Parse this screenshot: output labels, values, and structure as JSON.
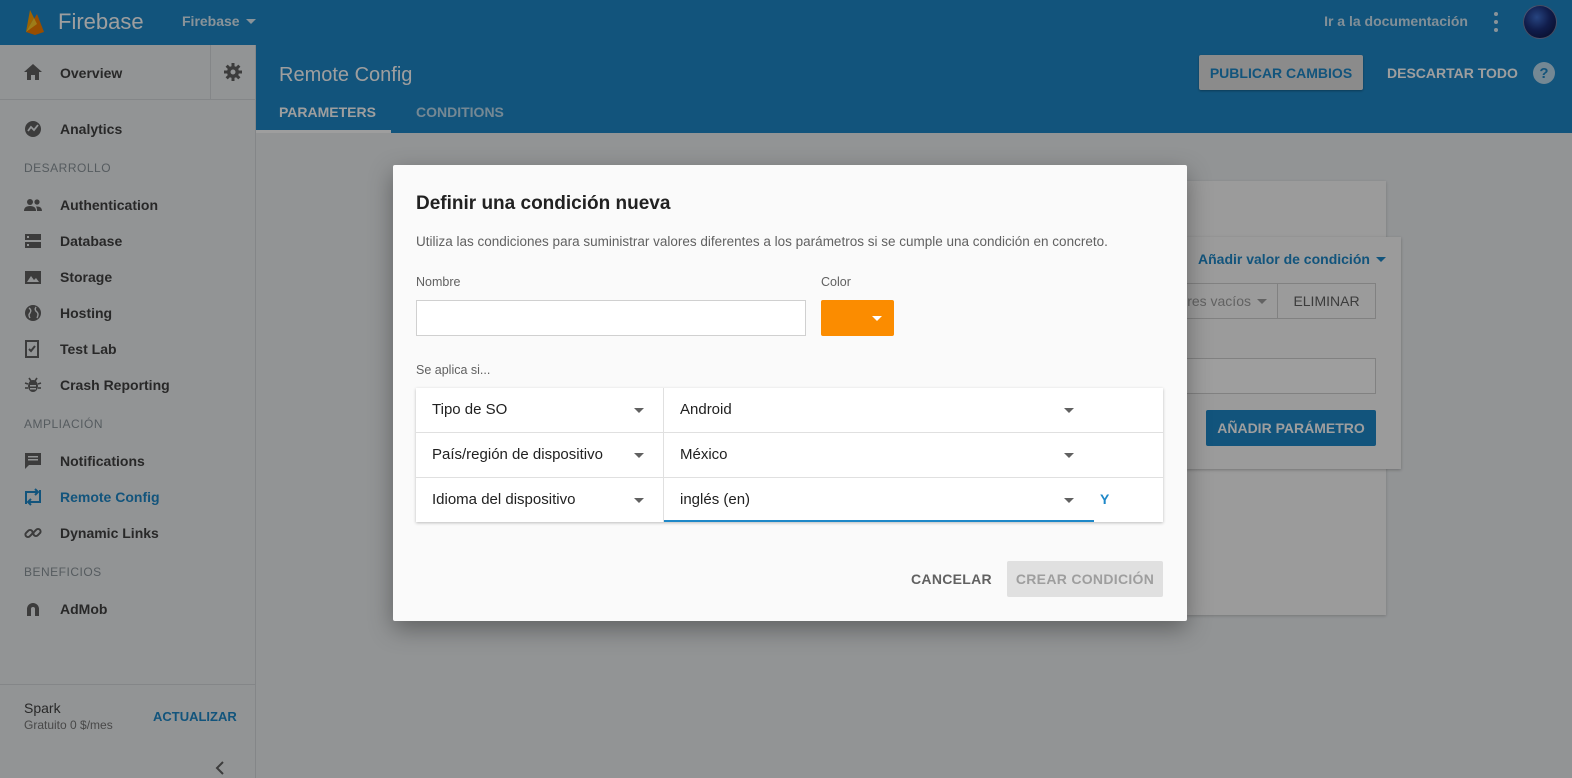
{
  "topbar": {
    "brand": "Firebase",
    "project": "Firebase",
    "doc_link": "Ir a la documentación"
  },
  "sidebar": {
    "overview": "Overview",
    "sections": {
      "develop": "DESARROLLO",
      "grow": "AMPLIACIÓN",
      "earn": "BENEFICIOS"
    },
    "items": [
      {
        "label": "Analytics",
        "icon": "analytics-icon"
      },
      {
        "label": "Authentication",
        "icon": "people-icon"
      },
      {
        "label": "Database",
        "icon": "database-icon"
      },
      {
        "label": "Storage",
        "icon": "image-icon"
      },
      {
        "label": "Hosting",
        "icon": "globe-icon"
      },
      {
        "label": "Test Lab",
        "icon": "checklist-icon"
      },
      {
        "label": "Crash Reporting",
        "icon": "bug-icon"
      },
      {
        "label": "Notifications",
        "icon": "message-icon"
      },
      {
        "label": "Remote Config",
        "icon": "remote-config-icon",
        "active": true
      },
      {
        "label": "Dynamic Links",
        "icon": "link-icon"
      },
      {
        "label": "AdMob",
        "icon": "admob-icon"
      }
    ],
    "plan": {
      "name": "Spark",
      "price": "Gratuito 0 $/mes",
      "upgrade": "ACTUALIZAR"
    }
  },
  "header": {
    "title": "Remote Config",
    "publish": "PUBLICAR CAMBIOS",
    "discard": "DESCARTAR TODO",
    "help": "?",
    "tabs": [
      {
        "label": "PARAMETERS",
        "active": true
      },
      {
        "label": "CONDITIONS",
        "active": false
      }
    ]
  },
  "background": {
    "add_condition_value": "Añadir valor de condición",
    "empty_values": "res vacíos",
    "delete": "ELIMINAR",
    "add_parameter": "AÑADIR PARÁMETRO"
  },
  "dialog": {
    "title": "Definir una condición nueva",
    "description": "Utiliza las condiciones para suministrar valores diferentes a los parámetros si se cumple una condición en concreto.",
    "name_label": "Nombre",
    "name_value": "",
    "color_label": "Color",
    "color_value": "#fb8c00",
    "applies_if": "Se aplica si...",
    "rules": [
      {
        "property": "Tipo de SO",
        "value": "Android"
      },
      {
        "property": "País/región de dispositivo",
        "value": "México"
      },
      {
        "property": "Idioma del dispositivo",
        "value": "inglés (en)"
      }
    ],
    "and": "Y",
    "cancel": "CANCELAR",
    "create": "CREAR CONDICIÓN"
  },
  "colors": {
    "primary": "#1e88c8",
    "accent_orange": "#fb8c00"
  }
}
